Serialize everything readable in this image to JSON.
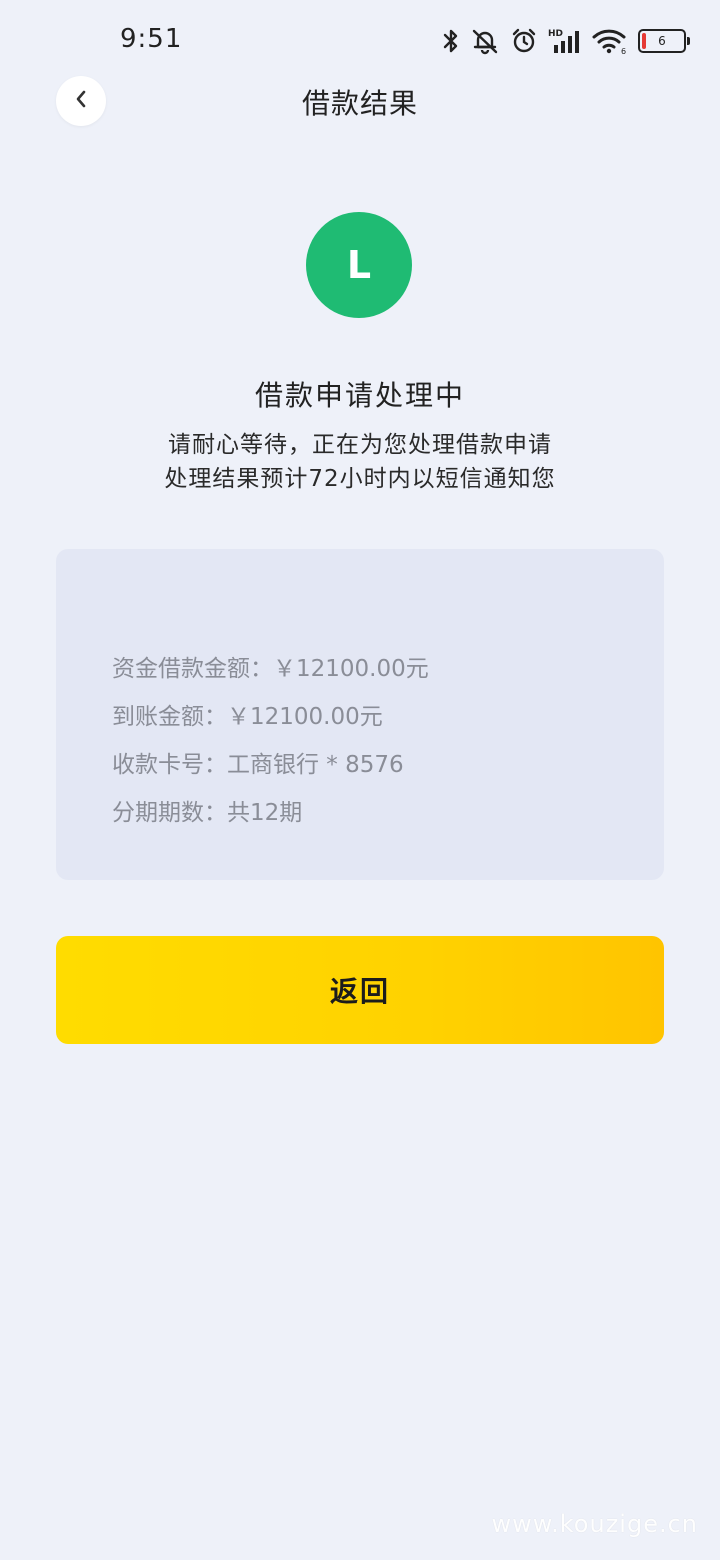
{
  "status_bar": {
    "time": "9:51",
    "battery_level": "6",
    "icons": [
      "bluetooth-icon",
      "notifications-muted-icon",
      "alarm-icon",
      "hd-signal-icon",
      "wifi-icon",
      "battery-icon"
    ],
    "hd_label": "HD",
    "wifi_label": "6"
  },
  "header": {
    "back_icon": "chevron-left-icon",
    "title": "借款结果"
  },
  "result": {
    "icon_letter": "L",
    "icon_color": "#1fbb73",
    "title": "借款申请处理中",
    "desc_line1": "请耐心等待，正在为您处理借款申请",
    "desc_line2": "处理结果预计72小时内以短信通知您"
  },
  "info": {
    "rows": [
      "资金借款金额：￥12100.00元",
      "到账金额：￥12100.00元",
      "收款卡号：工商银行 * 8576",
      "分期期数：共12期"
    ]
  },
  "actions": {
    "return_label": "返回",
    "return_color": "#ffd200"
  },
  "watermark": "www.kouzige.cn"
}
